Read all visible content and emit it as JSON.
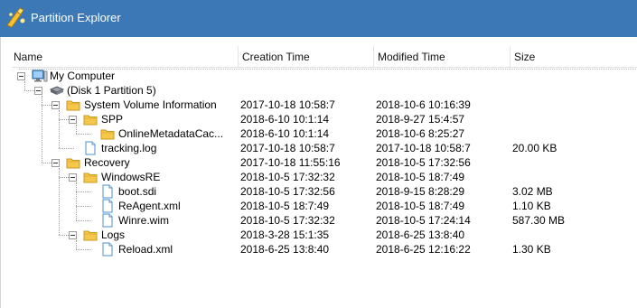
{
  "window": {
    "title": "Partition Explorer"
  },
  "columns": [
    {
      "label": "Name"
    },
    {
      "label": "Creation Time"
    },
    {
      "label": "Modified Time"
    },
    {
      "label": "Size"
    }
  ],
  "tree": [
    {
      "level": 0,
      "type": "computer",
      "expander": true,
      "name": "My Computer",
      "created": "",
      "modified": "",
      "size": ""
    },
    {
      "level": 1,
      "type": "disk",
      "expander": true,
      "name": "(Disk 1 Partition 5)",
      "created": "",
      "modified": "",
      "size": ""
    },
    {
      "level": 2,
      "type": "folder",
      "expander": true,
      "name": "System Volume Information",
      "created": "2017-10-18 10:58:7",
      "modified": "2018-10-6 10:16:39",
      "size": ""
    },
    {
      "level": 3,
      "type": "folder",
      "expander": true,
      "name": "SPP",
      "created": "2018-6-10 10:1:14",
      "modified": "2018-9-27 15:4:57",
      "size": ""
    },
    {
      "level": 4,
      "type": "folder",
      "expander": false,
      "name": "OnlineMetadataCac...",
      "created": "2018-6-10 10:1:14",
      "modified": "2018-10-6 8:25:27",
      "size": ""
    },
    {
      "level": 3,
      "type": "file",
      "expander": false,
      "name": "tracking.log",
      "created": "2017-10-18 10:58:7",
      "modified": "2017-10-18 10:58:7",
      "size": "20.00 KB"
    },
    {
      "level": 2,
      "type": "folder",
      "expander": true,
      "name": "Recovery",
      "created": "2017-10-18 11:55:16",
      "modified": "2018-10-5 17:32:56",
      "size": ""
    },
    {
      "level": 3,
      "type": "folder",
      "expander": true,
      "name": "WindowsRE",
      "created": "2018-10-5 17:32:32",
      "modified": "2018-10-5 18:7:49",
      "size": ""
    },
    {
      "level": 4,
      "type": "file",
      "expander": false,
      "name": "boot.sdi",
      "created": "2018-10-5 17:32:56",
      "modified": "2018-9-15 8:28:29",
      "size": "3.02 MB"
    },
    {
      "level": 4,
      "type": "file",
      "expander": false,
      "name": "ReAgent.xml",
      "created": "2018-10-5 18:7:49",
      "modified": "2018-10-5 18:7:49",
      "size": "1.10 KB"
    },
    {
      "level": 4,
      "type": "file",
      "expander": false,
      "name": "Winre.wim",
      "created": "2018-10-5 17:32:32",
      "modified": "2018-10-5 17:24:14",
      "size": "587.30 MB"
    },
    {
      "level": 3,
      "type": "folder",
      "expander": true,
      "name": "Logs",
      "created": "2018-3-28 15:1:35",
      "modified": "2018-6-25 13:8:40",
      "size": ""
    },
    {
      "level": 4,
      "type": "file",
      "expander": false,
      "name": "Reload.xml",
      "created": "2018-6-25 13:8:40",
      "modified": "2018-6-25 12:16:22",
      "size": "1.30 KB"
    }
  ],
  "colors": {
    "titlebar": "#3c78b5",
    "folder": "#f5c84c",
    "file_border": "#4f8fd0"
  }
}
